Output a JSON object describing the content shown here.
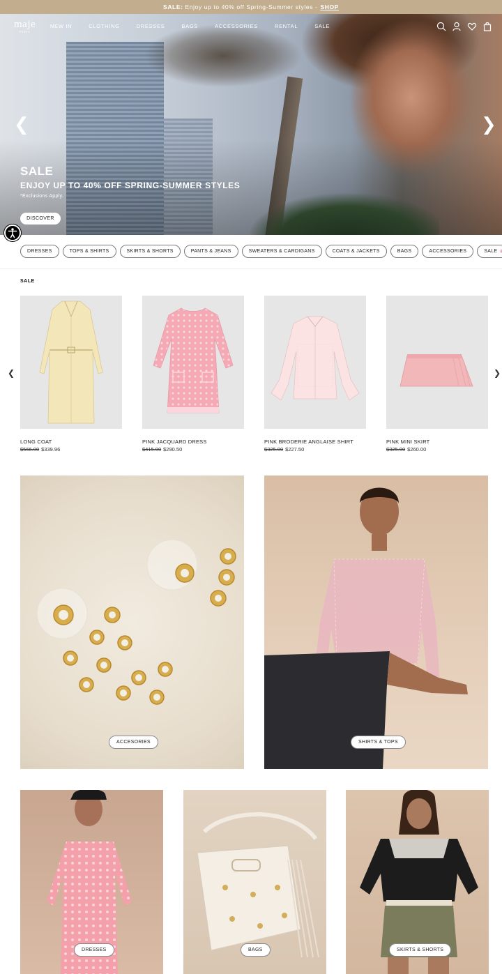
{
  "promo": {
    "label": "SALE:",
    "text": "Enjoy up to 40% off Spring-Summer styles -",
    "link": "SHOP"
  },
  "brand": {
    "logo": "maje",
    "logo_sub": "PARIS"
  },
  "nav": {
    "items": [
      "NEW IN",
      "CLOTHING",
      "DRESSES",
      "BAGS",
      "ACCESSORIES",
      "RENTAL",
      "SALE"
    ]
  },
  "nav_icons": [
    "search-icon",
    "account-icon",
    "wishlist-icon",
    "bag-icon"
  ],
  "hero": {
    "title": "SALE",
    "subtitle": "ENJOY UP TO 40% OFF SPRING-SUMMER STYLES",
    "note": "*Exclusions Apply.",
    "cta": "DISCOVER",
    "prev": "❮",
    "next": "❯"
  },
  "categories": [
    "DRESSES",
    "TOPS & SHIRTS",
    "SKIRTS & SHORTS",
    "PANTS & JEANS",
    "SWEATERS & CARDIGANS",
    "COATS & JACKETS",
    "BAGS",
    "ACCESSORIES",
    "SALE"
  ],
  "sale_section": {
    "label": "SALE",
    "prev": "❮",
    "next": "❯",
    "products": [
      {
        "name": "LONG COAT",
        "old_price": "$566.00",
        "price": "$339.96"
      },
      {
        "name": "PINK JACQUARD DRESS",
        "old_price": "$415.00",
        "price": "$290.50"
      },
      {
        "name": "PINK BRODERIE ANGLAISE SHIRT",
        "old_price": "$325.00",
        "price": "$227.50"
      },
      {
        "name": "PINK MINI SKIRT",
        "old_price": "$325.00",
        "price": "$260.00"
      }
    ]
  },
  "tiles": {
    "accessories": "ACCESORIES",
    "shirts": "SHIRTS & TOPS",
    "dresses": "DRESSES",
    "bags": "BAGS",
    "skirts": "SKIRTS & SHORTS"
  },
  "colors": {
    "promo_bg": "#c2ae8e",
    "accent_pink": "#f2a9b5"
  }
}
